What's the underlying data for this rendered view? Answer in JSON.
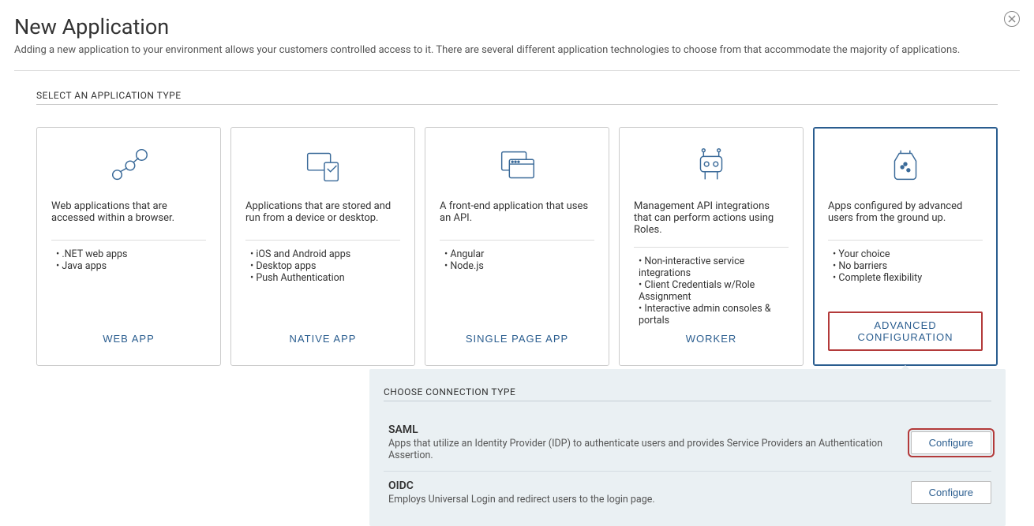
{
  "header": {
    "title": "New Application",
    "subtitle": "Adding a new application to your environment allows your customers controlled access to it. There are several different application technologies to choose from that accommodate the majority of applications."
  },
  "section_label": "SELECT AN APPLICATION TYPE",
  "cards": [
    {
      "desc": "Web applications that are accessed within a browser.",
      "bullets": [
        ".NET web apps",
        "Java apps"
      ],
      "button": "WEB APP"
    },
    {
      "desc": "Applications that are stored and run from a device or desktop.",
      "bullets": [
        "iOS and Android apps",
        "Desktop apps",
        "Push Authentication"
      ],
      "button": "NATIVE APP"
    },
    {
      "desc": "A front-end application that uses an API.",
      "bullets": [
        "Angular",
        "Node.js"
      ],
      "button": "SINGLE PAGE APP"
    },
    {
      "desc": "Management API integrations that can perform actions using Roles.",
      "bullets": [
        "Non-interactive service integrations",
        "Client Credentials w/Role Assignment",
        "Interactive admin consoles & portals"
      ],
      "button": "WORKER"
    },
    {
      "desc": "Apps configured by advanced users from the ground up.",
      "bullets": [
        "Your choice",
        "No barriers",
        "Complete flexibility"
      ],
      "button": "ADVANCED CONFIGURATION"
    }
  ],
  "connection": {
    "label": "CHOOSE CONNECTION TYPE",
    "rows": [
      {
        "title": "SAML",
        "desc": "Apps that utilize an Identity Provider (IDP) to authenticate users and provides Service Providers an Authentication Assertion.",
        "button": "Configure"
      },
      {
        "title": "OIDC",
        "desc": "Employs Universal Login and redirect users to the login page.",
        "button": "Configure"
      }
    ]
  }
}
